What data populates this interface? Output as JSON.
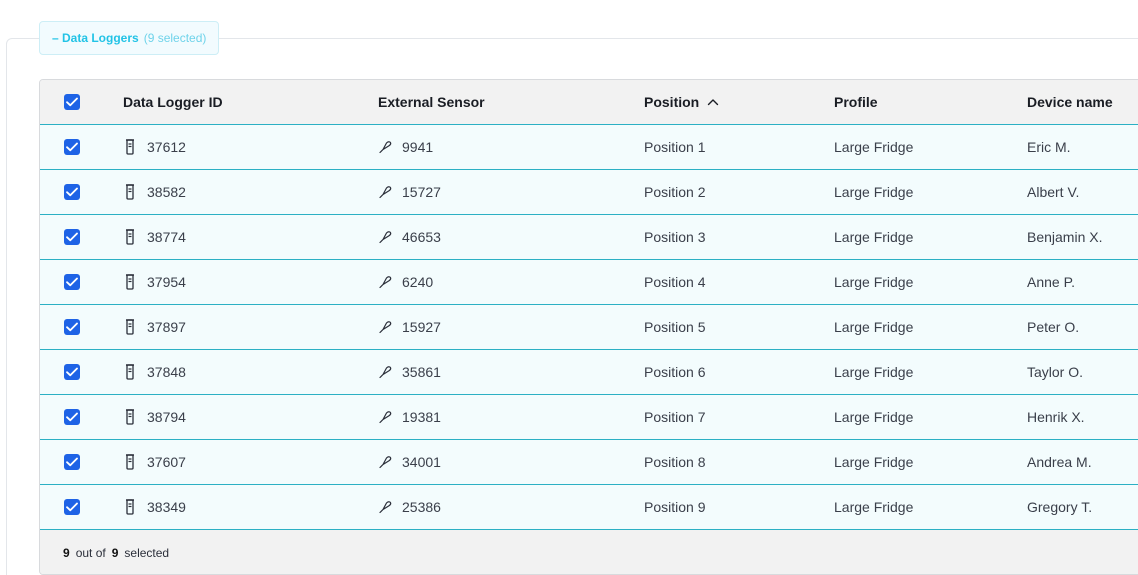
{
  "section": {
    "toggle_label": "– Data Loggers",
    "count_label": "(9 selected)"
  },
  "table": {
    "headers": {
      "logger_id": "Data Logger ID",
      "sensor": "External Sensor",
      "position": "Position",
      "profile": "Profile",
      "device": "Device name"
    },
    "sort": {
      "column": "position",
      "direction": "ascending"
    },
    "rows": [
      {
        "logger_id": "37612",
        "sensor": "9941",
        "position": "Position 1",
        "profile": "Large Fridge",
        "device": "Eric M.",
        "checked": true
      },
      {
        "logger_id": "38582",
        "sensor": "15727",
        "position": "Position 2",
        "profile": "Large Fridge",
        "device": "Albert V.",
        "checked": true
      },
      {
        "logger_id": "38774",
        "sensor": "46653",
        "position": "Position 3",
        "profile": "Large Fridge",
        "device": "Benjamin X.",
        "checked": true
      },
      {
        "logger_id": "37954",
        "sensor": "6240",
        "position": "Position 4",
        "profile": "Large Fridge",
        "device": "Anne P.",
        "checked": true
      },
      {
        "logger_id": "37897",
        "sensor": "15927",
        "position": "Position 5",
        "profile": "Large Fridge",
        "device": "Peter O.",
        "checked": true
      },
      {
        "logger_id": "37848",
        "sensor": "35861",
        "position": "Position 6",
        "profile": "Large Fridge",
        "device": "Taylor O.",
        "checked": true
      },
      {
        "logger_id": "38794",
        "sensor": "19381",
        "position": "Position 7",
        "profile": "Large Fridge",
        "device": "Henrik X.",
        "checked": true
      },
      {
        "logger_id": "37607",
        "sensor": "34001",
        "position": "Position 8",
        "profile": "Large Fridge",
        "device": "Andrea M.",
        "checked": true
      },
      {
        "logger_id": "38349",
        "sensor": "25386",
        "position": "Position 9",
        "profile": "Large Fridge",
        "device": "Gregory T.",
        "checked": true
      }
    ],
    "footer": {
      "selected": "9",
      "out_of_label": "out of",
      "total": "9",
      "selected_label": "selected"
    }
  },
  "icons": {
    "logger": "data-logger-icon",
    "sensor": "probe-icon",
    "checkbox": "checkmark-icon",
    "sort": "chevron-up-icon"
  },
  "colors": {
    "accent": "#1e63e6",
    "row_border": "#2bb0c4",
    "legend_text": "#22c3e6",
    "row_bg": "#f3fcfd",
    "header_bg": "#f2f2f2"
  }
}
